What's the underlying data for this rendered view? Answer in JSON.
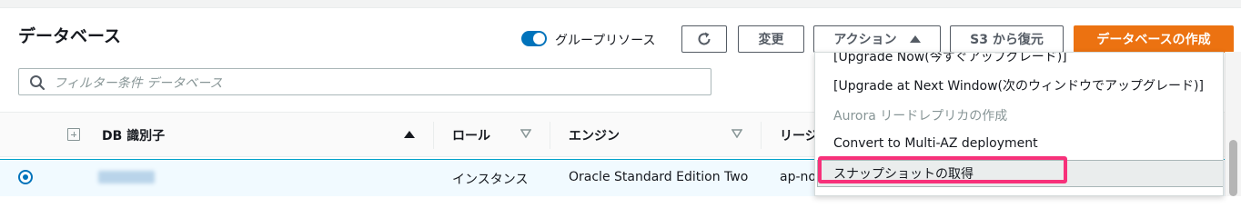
{
  "header": {
    "title": "データベース",
    "group_toggle_label": "グループリソース",
    "buttons": {
      "modify": "変更",
      "actions": "アクション",
      "restore_s3": "S3 から復元",
      "create": "データベースの作成"
    }
  },
  "search": {
    "placeholder": "フィルター条件 データベース"
  },
  "table": {
    "columns": {
      "db_identifier": "DB 識別子",
      "role": "ロール",
      "engine": "エンジン",
      "region": "リージ"
    },
    "rows": [
      {
        "role": "インスタンス",
        "engine": "Oracle Standard Edition Two",
        "region": "ap-no"
      }
    ]
  },
  "actions_menu": {
    "items": [
      {
        "label": "[Upgrade Now(今すぐアップグレード)]",
        "disabled": false
      },
      {
        "label": "[Upgrade at Next Window(次のウィンドウでアップグレード)]",
        "disabled": false
      },
      {
        "label": "Aurora リードレプリカの作成",
        "disabled": true
      },
      {
        "label": "Convert to Multi-AZ deployment",
        "disabled": false
      },
      {
        "label": "スナップショットの取得",
        "disabled": false
      }
    ]
  },
  "colors": {
    "primary_button": "#ec7211",
    "toggle_on": "#0073bb",
    "highlight_box": "#f7317a",
    "selected_row": "#f1faff"
  },
  "icons": [
    "refresh-icon",
    "search-icon",
    "expand-all-icon",
    "sort-ascending-icon",
    "sort-descending-icon",
    "caret-up-icon"
  ]
}
